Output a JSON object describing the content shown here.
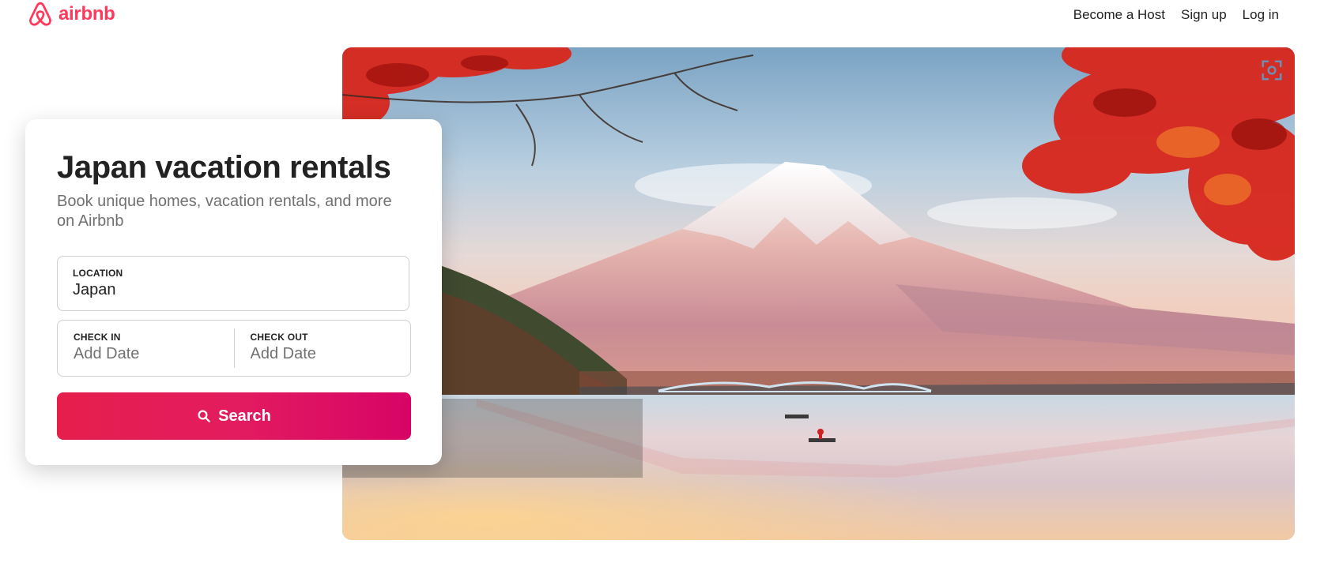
{
  "brand": {
    "logo_text": "airbnb",
    "color": "#FF385C"
  },
  "nav": {
    "become_host": "Become a Host",
    "sign_up": "Sign up",
    "log_in": "Log in"
  },
  "card": {
    "title": "Japan vacation rentals",
    "subtitle": "Book unique homes, vacation rentals, and more on Airbnb",
    "location_label": "LOCATION",
    "location_value": "Japan",
    "checkin_label": "CHECK IN",
    "checkin_placeholder": "Add Date",
    "checkout_label": "CHECK OUT",
    "checkout_placeholder": "Add Date",
    "search_label": "Search",
    "search_colors": [
      "#E61E4D",
      "#E31C5F",
      "#D70466"
    ]
  },
  "hero": {
    "icons": [
      "expand-icon"
    ]
  }
}
